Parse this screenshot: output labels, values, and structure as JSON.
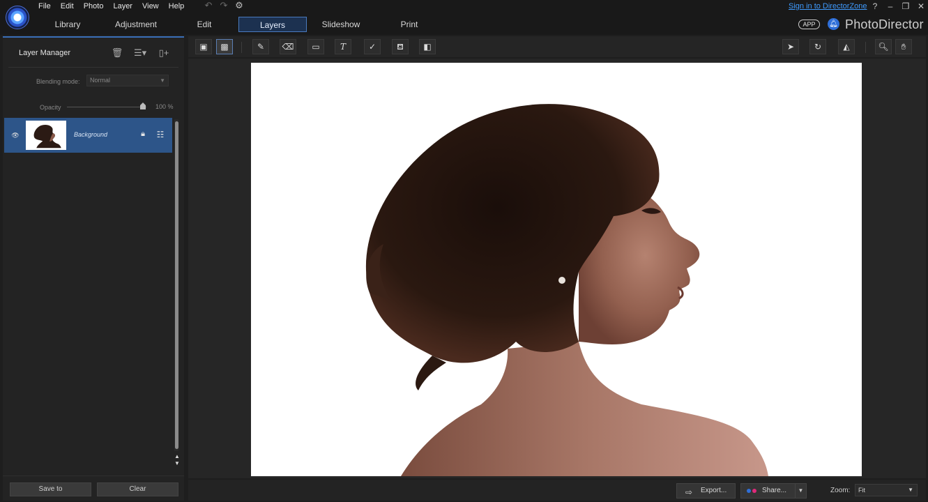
{
  "menu": [
    "File",
    "Edit",
    "Photo",
    "Layer",
    "View",
    "Help"
  ],
  "main_tabs": [
    {
      "label": "Library"
    },
    {
      "label": "Adjustment"
    },
    {
      "label": "Edit"
    },
    {
      "label": "Layers",
      "active": true
    },
    {
      "label": "Slideshow"
    },
    {
      "label": "Print"
    }
  ],
  "header": {
    "signin": "Sign in to DirectorZone",
    "help": "?",
    "app_badge": "APP",
    "brand": "PhotoDirector"
  },
  "layer_manager": {
    "title": "Layer Manager",
    "blending_label": "Blending mode:",
    "blending_value": "Normal",
    "opacity_label": "Opacity",
    "opacity_value": "100 %",
    "opacity_fraction": 1.0,
    "layers": [
      {
        "name": "Background",
        "visible": true,
        "locked": true,
        "selected": true
      }
    ],
    "save_label": "Save to",
    "clear_label": "Clear"
  },
  "bottom": {
    "export_label": "Export...",
    "share_label": "Share...",
    "zoom_label": "Zoom:",
    "zoom_value": "Fit"
  },
  "colors": {
    "accent": "#3a6fb8",
    "selected_layer": "#2d5589",
    "link": "#3f9bff"
  },
  "icons": [
    "undo-icon",
    "redo-icon",
    "settings-icon",
    "trash-icon",
    "layer-options-icon",
    "new-layer-icon",
    "eye-icon",
    "lock-icon",
    "layer-adjust-icon",
    "brush-icon",
    "eraser-icon",
    "rectangle-icon",
    "text-icon",
    "clone-icon",
    "fill-icon",
    "gradient-icon",
    "select-arrow-icon",
    "rotate-icon",
    "flip-icon",
    "zoom-icon",
    "hand-icon",
    "export-icon",
    "share-icon"
  ]
}
